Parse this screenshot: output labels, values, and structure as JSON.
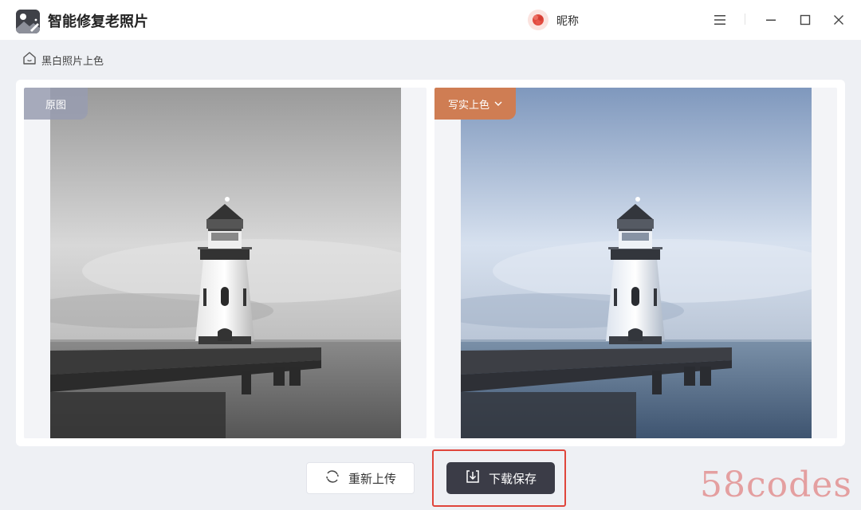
{
  "app": {
    "title": "智能修复老照片",
    "logo_icon": "photo-magic-icon"
  },
  "user": {
    "nickname": "昵称",
    "avatar_icon": "red-flower-avatar"
  },
  "window_controls": {
    "menu_icon": "hamburger-menu-icon",
    "minimize_icon": "minimize-icon",
    "maximize_icon": "maximize-icon",
    "close_icon": "close-icon"
  },
  "breadcrumb": {
    "icon": "home-icon",
    "label": "黑白照片上色"
  },
  "images": {
    "original_label": "原图",
    "result_mode_label": "写实上色",
    "result_mode_icon": "chevron-down-icon"
  },
  "actions": {
    "reupload_label": "重新上传",
    "reupload_icon": "refresh-icon",
    "download_label": "下载保存",
    "download_icon": "download-icon"
  },
  "watermark": "58codes",
  "colors": {
    "accent_tag": "#cf7d53",
    "primary_button": "#3b3c47",
    "highlight_border": "#e0453b",
    "watermark": "#e08484"
  }
}
